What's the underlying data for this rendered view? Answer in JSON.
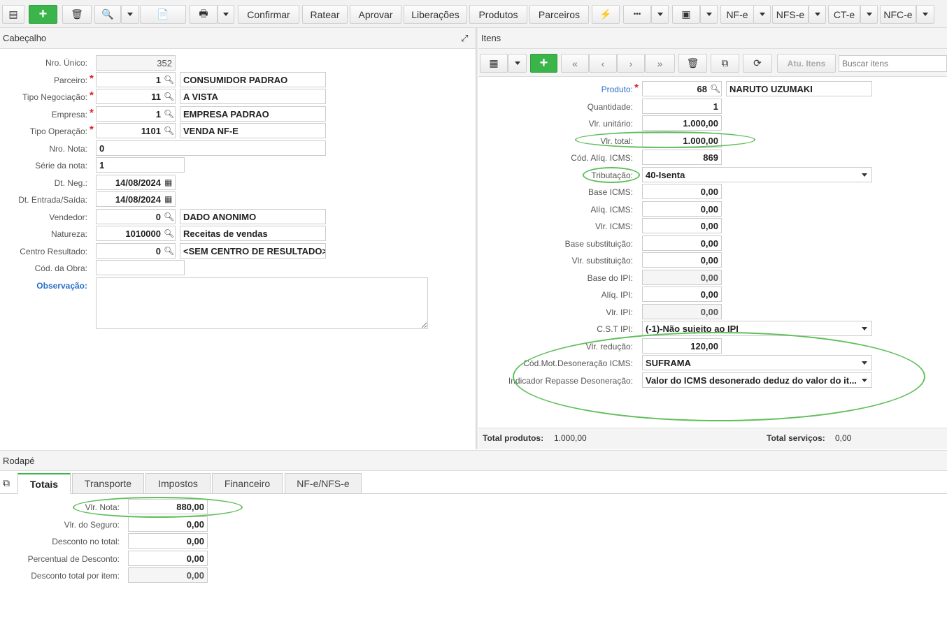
{
  "toolbar": {
    "buttons": [
      "Confirmar",
      "Ratear",
      "Aprovar",
      "Liberações",
      "Produtos",
      "Parceiros"
    ],
    "doc_buttons": [
      "NF-e",
      "NFS-e",
      "CT-e",
      "NFC-e"
    ],
    "more": "•••"
  },
  "header": {
    "title": "Cabeçalho",
    "nro_unico_label": "Nro. Único:",
    "nro_unico": "352",
    "parceiro_label": "Parceiro:",
    "parceiro_code": "1",
    "parceiro_name": "CONSUMIDOR PADRAO",
    "tipo_neg_label": "Tipo Negociação:",
    "tipo_neg_code": "11",
    "tipo_neg_name": "A VISTA",
    "empresa_label": "Empresa:",
    "empresa_code": "1",
    "empresa_name": "EMPRESA PADRAO",
    "tipo_op_label": "Tipo Operação:",
    "tipo_op_code": "1101",
    "tipo_op_name": "VENDA NF-E",
    "nro_nota_label": "Nro. Nota:",
    "nro_nota": "0",
    "serie_label": "Série da nota:",
    "serie": "1",
    "dt_neg_label": "Dt. Neg.:",
    "dt_neg": "14/08/2024",
    "dt_entrada_label": "Dt. Entrada/Saída:",
    "dt_entrada": "14/08/2024",
    "vendedor_label": "Vendedor:",
    "vendedor_code": "0",
    "vendedor_name": "DADO ANONIMO",
    "natureza_label": "Natureza:",
    "natureza_code": "1010000",
    "natureza_name": "Receitas de vendas",
    "centro_label": "Centro Resultado:",
    "centro_code": "0",
    "centro_name": "<SEM CENTRO DE RESULTADO>",
    "obra_label": "Cód. da Obra:",
    "obra": "",
    "obs_label": "Observação:"
  },
  "items": {
    "title": "Itens",
    "atu_itens": "Atu. Itens",
    "search_placeholder": "Buscar itens",
    "produto_label": "Produto:",
    "produto_code": "68",
    "produto_name": "NARUTO UZUMAKI",
    "quantidade_label": "Quantidade:",
    "quantidade": "1",
    "vlr_unit_label": "Vlr. unitário:",
    "vlr_unit": "1.000,00",
    "vlr_total_label": "Vlr. total:",
    "vlr_total": "1.000,00",
    "cod_aliq_label": "Cód. Alíq. ICMS:",
    "cod_aliq": "869",
    "tributacao_label": "Tributação:",
    "tributacao": "40-Isenta",
    "base_icms_label": "Base ICMS:",
    "base_icms": "0,00",
    "aliq_icms_label": "Alíq. ICMS:",
    "aliq_icms": "0,00",
    "vlr_icms_label": "Vlr. ICMS:",
    "vlr_icms": "0,00",
    "base_sub_label": "Base substituição:",
    "base_sub": "0,00",
    "vlr_sub_label": "Vlr. substituição:",
    "vlr_sub": "0,00",
    "base_ipi_label": "Base do IPI:",
    "base_ipi": "0,00",
    "aliq_ipi_label": "Alíq. IPI:",
    "aliq_ipi": "0,00",
    "vlr_ipi_label": "Vlr. IPI:",
    "vlr_ipi": "0,00",
    "cst_ipi_label": "C.S.T IPI:",
    "cst_ipi": "(-1)-Não sujeito ao IPI",
    "vlr_reducao_label": "Vlr. redução:",
    "vlr_reducao": "120,00",
    "cod_mot_label": "Cód.Mot.Desoneração ICMS:",
    "cod_mot": "SUFRAMA",
    "indicador_label": "Indicador Repasse Desoneração:",
    "indicador": "Valor do ICMS desonerado deduz do valor do it...",
    "total_produtos_label": "Total produtos:",
    "total_produtos": "1.000,00",
    "total_servicos_label": "Total serviços:",
    "total_servicos": "0,00"
  },
  "footer": {
    "title": "Rodapé",
    "tabs": [
      "Totais",
      "Transporte",
      "Impostos",
      "Financeiro",
      "NF-e/NFS-e"
    ],
    "vlr_nota_label": "Vlr. Nota:",
    "vlr_nota": "880,00",
    "vlr_seguro_label": "Vlr. do Seguro:",
    "vlr_seguro": "0,00",
    "desconto_label": "Desconto no total:",
    "desconto": "0,00",
    "percentual_label": "Percentual de Desconto:",
    "percentual": "0,00",
    "desc_item_label": "Desconto total por item:",
    "desc_item": "0,00"
  },
  "colors": {
    "accent_green": "#3bb54a",
    "annotation_green": "#5fbf5a",
    "link_blue": "#2a6fc9",
    "required_red": "#d22"
  }
}
